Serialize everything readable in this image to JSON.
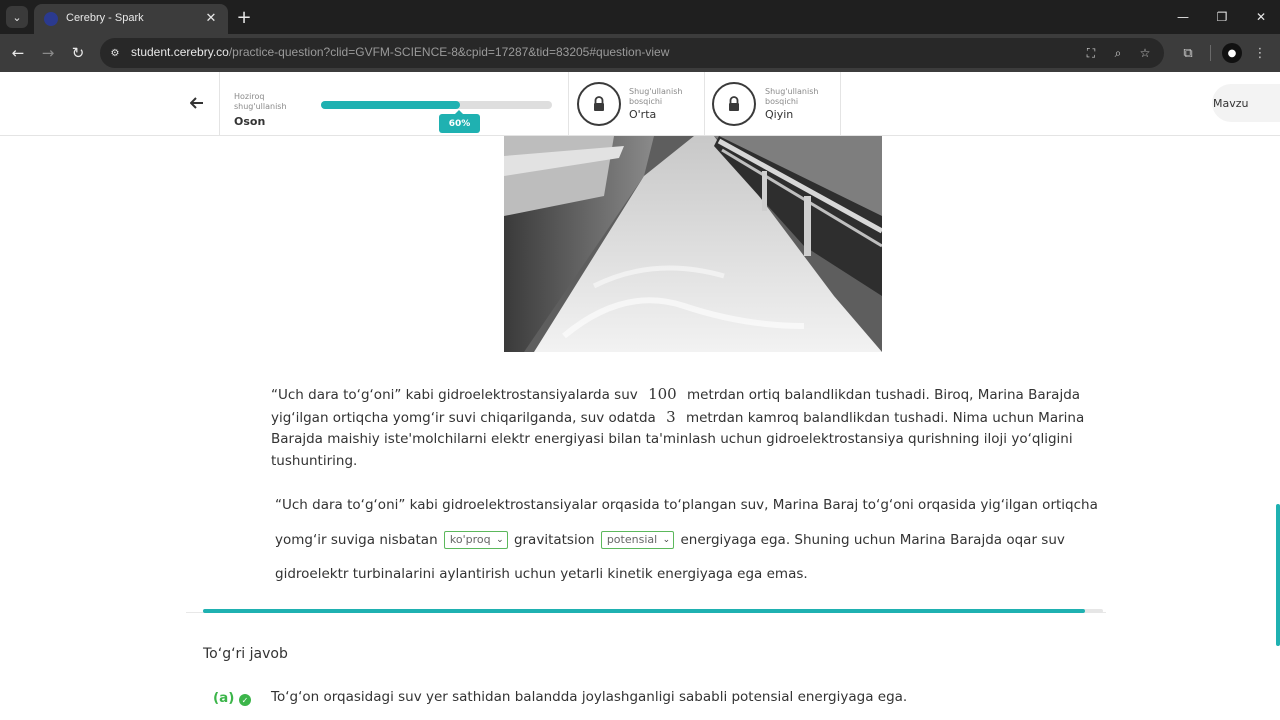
{
  "browser": {
    "tab_title": "Cerebry - Spark",
    "url_host": "student.cerebry.co",
    "url_path": "/practice-question?clid=GVFM-SCIENCE-8&cpid=17287&tid=83205#question-view"
  },
  "header": {
    "current_level_label": "Hoziroq shug'ullanish",
    "current_level_name": "Oson",
    "progress_label": "60%",
    "progress_value": 0.6,
    "stages": [
      {
        "label": "Shug'ullanish bosqichi",
        "name": "O'rta",
        "locked": true
      },
      {
        "label": "Shug'ullanish bosqichi",
        "name": "Qiyin",
        "locked": true
      }
    ],
    "topic_button": "Mavzu"
  },
  "question": {
    "part1": "“Uch dara to‘g‘oni” kabi gidroelektrostansiyalarda suv",
    "number1": "100",
    "part2": "metrdan ortiq balandlikdan tushadi. Biroq, Marina Barajda yig‘ilgan ortiqcha yomg‘ir suvi chiqarilganda, suv odatda",
    "number2": "3",
    "part3": "metrdan kamroq balandlikdan tushadi. Nima uchun Marina Barajda maishiy iste'molchilarni elektr energiyasi bilan ta'minlash uchun gidroelektrostansiya qurishning iloji yo‘qligini tushuntiring."
  },
  "answer": {
    "text1": "“Uch dara to‘g‘oni” kabi gidroelektrostansiyalar orqasida to‘plangan suv, Marina Baraj to‘g‘oni orqasida yig‘ilgan ortiqcha yomg‘ir suviga nisbatan",
    "dropdown1": "ko'proq",
    "text2": "gravitatsion",
    "dropdown2": "potensial",
    "text3": "energiyaga ega. Shuning uchun Marina Barajda oqar suv gidroelektr turbinalarini aylantirish uchun yetarli kinetik energiyaga ega emas."
  },
  "bottom_progress": 0.98,
  "correct_answer": {
    "title": "To‘g‘ri javob",
    "option_letter": "(a)",
    "option_text": "To‘g‘on orqasidagi suv yer sathidan balandda joylashganligi sababli potensial energiyaga ega."
  },
  "colors": {
    "accent": "#1fb1b1",
    "correct": "#3cb54a"
  }
}
